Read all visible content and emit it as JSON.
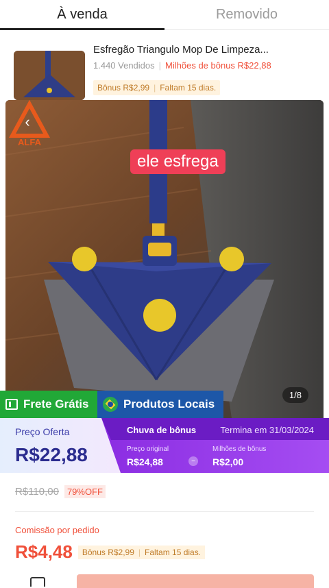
{
  "tabs": [
    {
      "label": "À venda",
      "active": true
    },
    {
      "label": "Removido",
      "active": false
    }
  ],
  "product": {
    "title": "Esfregão Triangulo Mop De Limpeza...",
    "sold": "1.440 Vendidos",
    "bonus_millions": "Milhões de bônus R$22,88",
    "bonus_tag": "Bônus R$2,99",
    "days_left": "Faltam 15 dias."
  },
  "hero": {
    "caption": "ele esfrega",
    "counter": "1/8",
    "logo_text": "ALFA"
  },
  "badges": {
    "free_shipping": "Frete Grátis",
    "local_products": "Produtos Locais"
  },
  "price": {
    "offer_label": "Preço Oferta",
    "offer_value": "R$22,88",
    "rain_title": "Chuva de bônus",
    "rain_end": "Termina em 31/03/2024",
    "original_label": "Preço original",
    "original_value": "R$24,88",
    "minus_sign": "−",
    "millions_label": "Milhões de bônus",
    "millions_value": "R$2,00"
  },
  "discount": {
    "old_price": "R$110,00",
    "off": "79%OFF"
  },
  "commission": {
    "label": "Comissão por pedido",
    "value": "R$4,48",
    "bonus_tag": "Bônus R$2,99",
    "days_left": "Faltam 15 dias."
  },
  "colors": {
    "accent_red": "#f0503a",
    "purple": "#8b2de2",
    "green_badge": "#21a837",
    "blue_badge": "#1d57a8",
    "caption_bg": "#ef3f57"
  },
  "icons": [
    "back-arrow-icon",
    "truck-icon",
    "brazil-flag-icon",
    "store-icon"
  ]
}
